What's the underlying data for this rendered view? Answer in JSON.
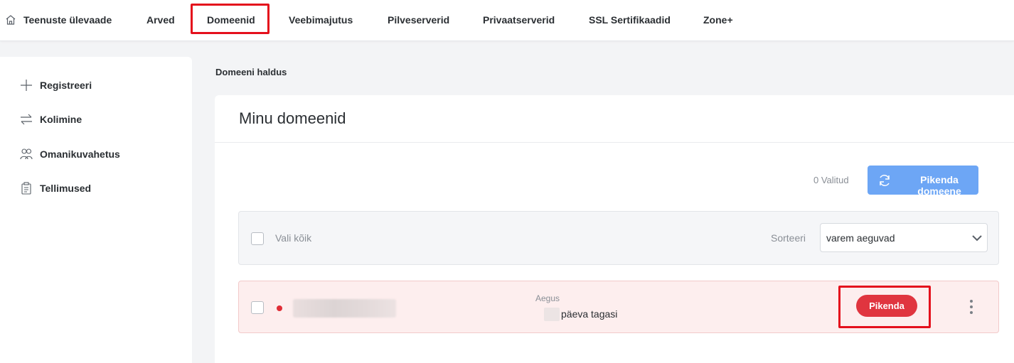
{
  "nav": {
    "home": "Teenuste ülevaade",
    "invoices": "Arved",
    "domains": "Domeenid",
    "hosting": "Veebimajutus",
    "cloud": "Pilveserverid",
    "private": "Privaatserverid",
    "ssl": "SSL Sertifikaadid",
    "zoneplus": "Zone+"
  },
  "sidebar": {
    "items": [
      {
        "label": "Registreeri",
        "icon": "plus-icon"
      },
      {
        "label": "Kolimine",
        "icon": "transfer-arrows-icon"
      },
      {
        "label": "Omanikuvahetus",
        "icon": "users-icon"
      },
      {
        "label": "Tellimused",
        "icon": "clipboard-icon"
      }
    ]
  },
  "breadcrumb": "Domeeni haldus",
  "card": {
    "title": "Minu domeenid",
    "selected_count": "0 Valitud",
    "renew_button": "Pikenda domeene",
    "select_all": "Vali kõik",
    "sort_label": "Sorteeri",
    "sort_value": "varem aeguvad"
  },
  "domain_row": {
    "expiry_label": "Aegus",
    "expiry_value": "päeva tagasi",
    "action": "Pikenda",
    "status_color": "#e02d36"
  },
  "colors": {
    "accent": "#6da6f5",
    "danger": "#e0353f",
    "highlight": "#e4101c"
  }
}
